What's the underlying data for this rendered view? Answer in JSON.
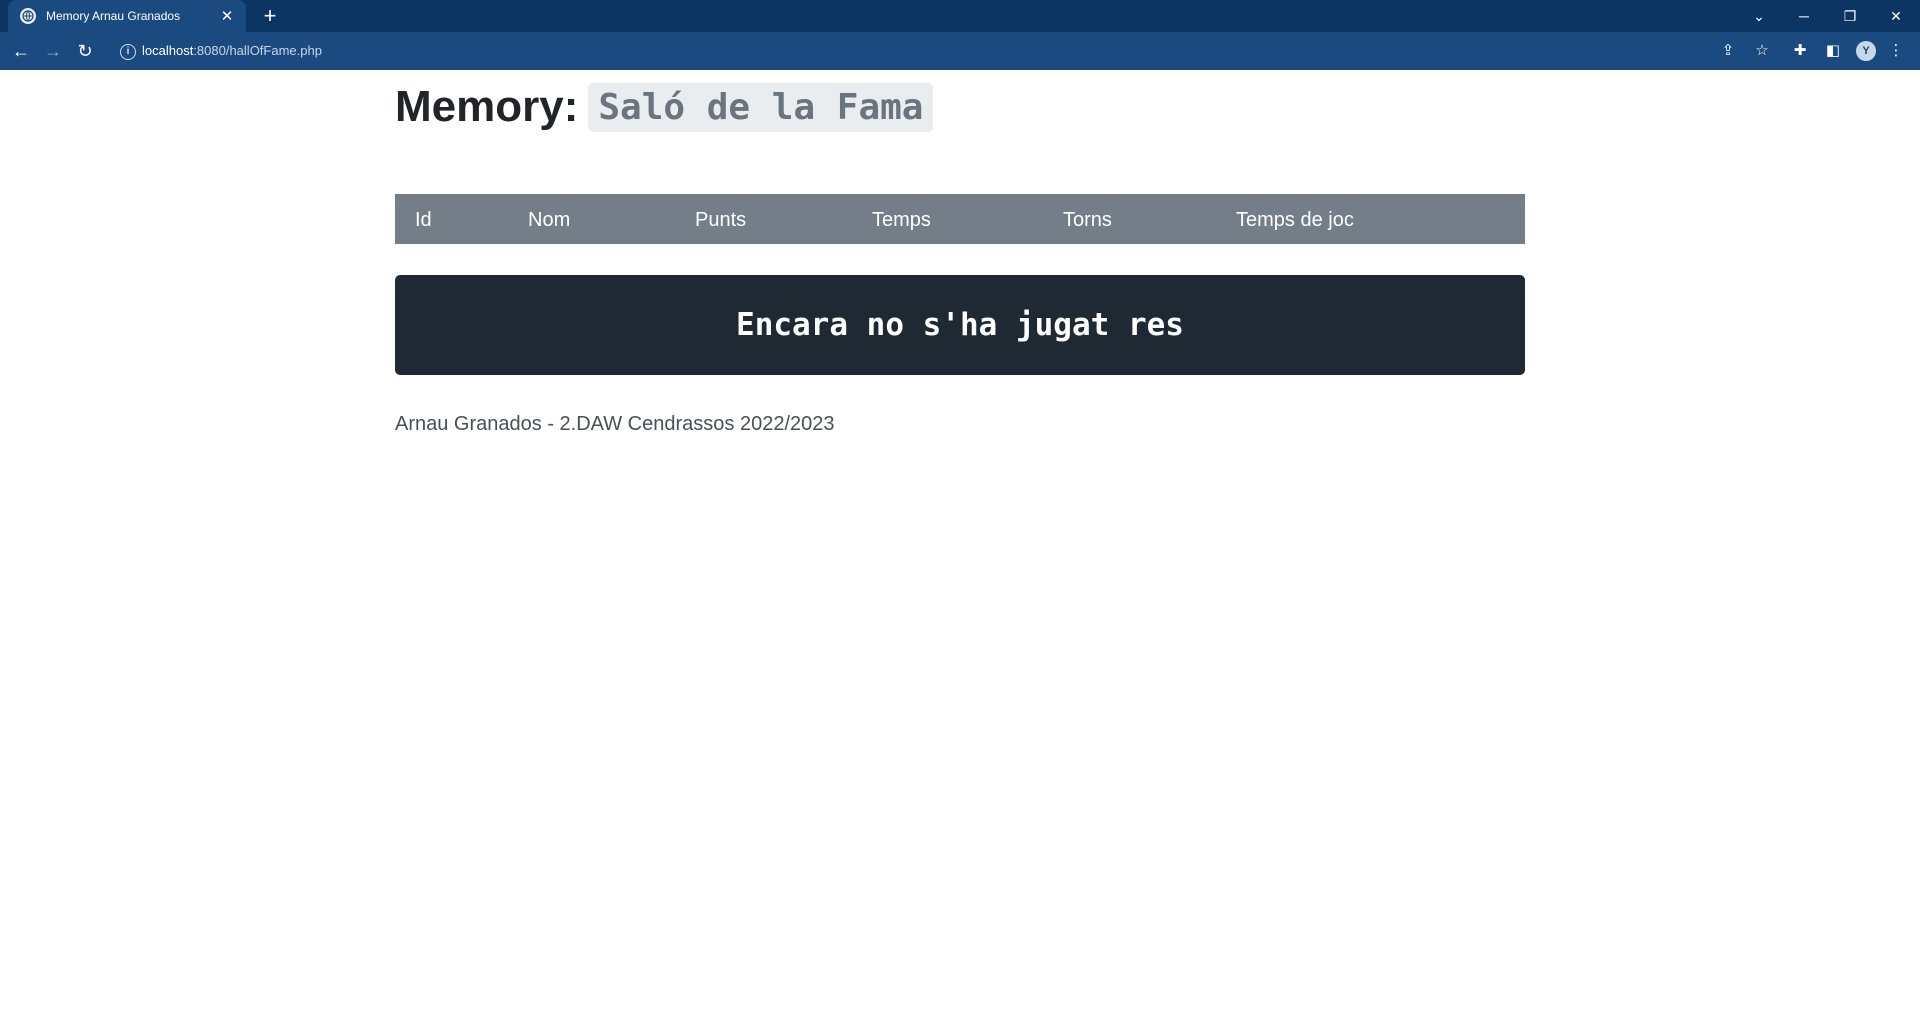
{
  "browser": {
    "tab_title": "Memory Arnau Granados",
    "url_host": "localhost",
    "url_rest": ":8080/hallOfFame.php"
  },
  "page": {
    "title_main": "Memory:",
    "title_sub": "Saló de la Fama",
    "table_headers": [
      "Id",
      "Nom",
      "Punts",
      "Temps",
      "Torns",
      "Temps de joc"
    ],
    "empty_message": "Encara no s'ha jugat res",
    "footer": "Arnau Granados - 2.DAW Cendrassos 2022/2023"
  },
  "colors": {
    "chrome": "#0d3563",
    "toolbar": "#1b4a80",
    "table_header": "#747e88",
    "empty_box": "#1f2933"
  }
}
